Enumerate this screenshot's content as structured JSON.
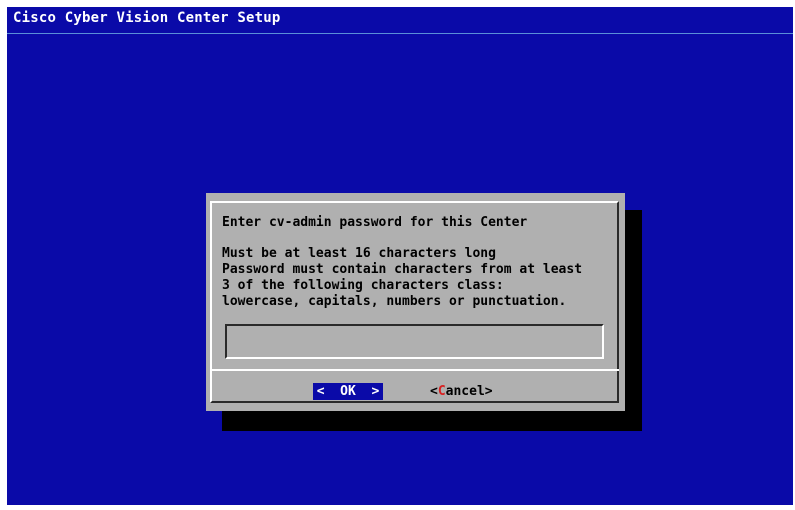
{
  "backtitle": "Cisco Cyber Vision Center Setup",
  "dialog": {
    "heading": "Enter cv-admin password for this Center",
    "message_lines": [
      "Must be at least 16 characters long",
      "Password must contain characters from at least",
      "3 of the following characters class:",
      "lowercase, capitals, numbers or punctuation."
    ],
    "password_value": "",
    "buttons": {
      "ok": {
        "left": "<",
        "label": "OK",
        "right": ">"
      },
      "cancel": {
        "left": "<",
        "hotkey": "C",
        "rest": "ancel",
        "right": ">"
      }
    }
  },
  "colors": {
    "background": "#0a0aa8",
    "dialog": "#b0b0b0",
    "hotkey": "#d82020",
    "selected_button_bg": "#0a0aa8"
  }
}
